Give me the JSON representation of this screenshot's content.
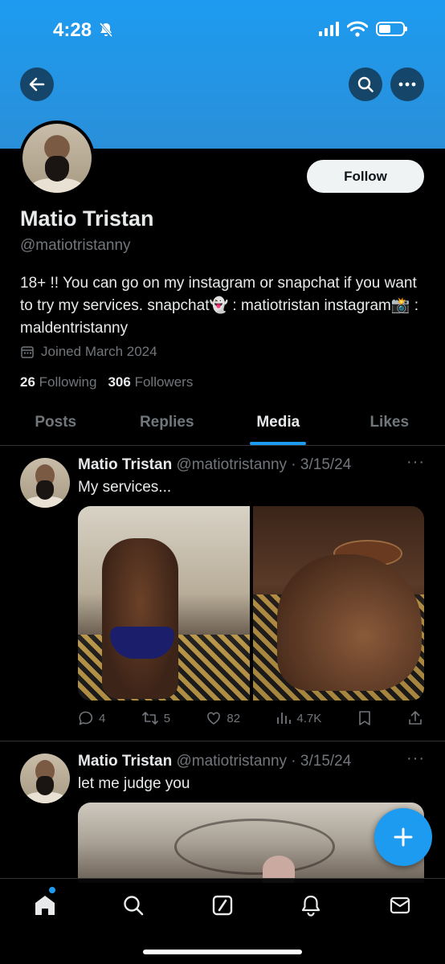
{
  "status_bar": {
    "time": "4:28"
  },
  "profile": {
    "name": "Matio Tristan",
    "handle": "@matiotristanny",
    "bio": "18+ !! You can go on my instagram or snapchat if you want to try my services. snapchat👻 : matiotristan instagram📸 : maldentristanny",
    "joined": "Joined March 2024",
    "following_count": "26",
    "following_label": "Following",
    "followers_count": "306",
    "followers_label": "Followers",
    "follow_label": "Follow"
  },
  "tabs": [
    {
      "label": "Posts"
    },
    {
      "label": "Replies"
    },
    {
      "label": "Media",
      "active": true
    },
    {
      "label": "Likes"
    }
  ],
  "tweets": [
    {
      "name": "Matio Tristan",
      "meta": "@matiotristanny · 3/15/24",
      "text": "My services...",
      "replies": "4",
      "reposts": "5",
      "likes": "82",
      "views": "4.7K"
    },
    {
      "name": "Matio Tristan",
      "meta": "@matiotristanny · 3/15/24",
      "text": "let me judge you"
    }
  ],
  "colors": {
    "accent": "#1d9bf0",
    "background": "#000000",
    "muted": "#71767b"
  }
}
